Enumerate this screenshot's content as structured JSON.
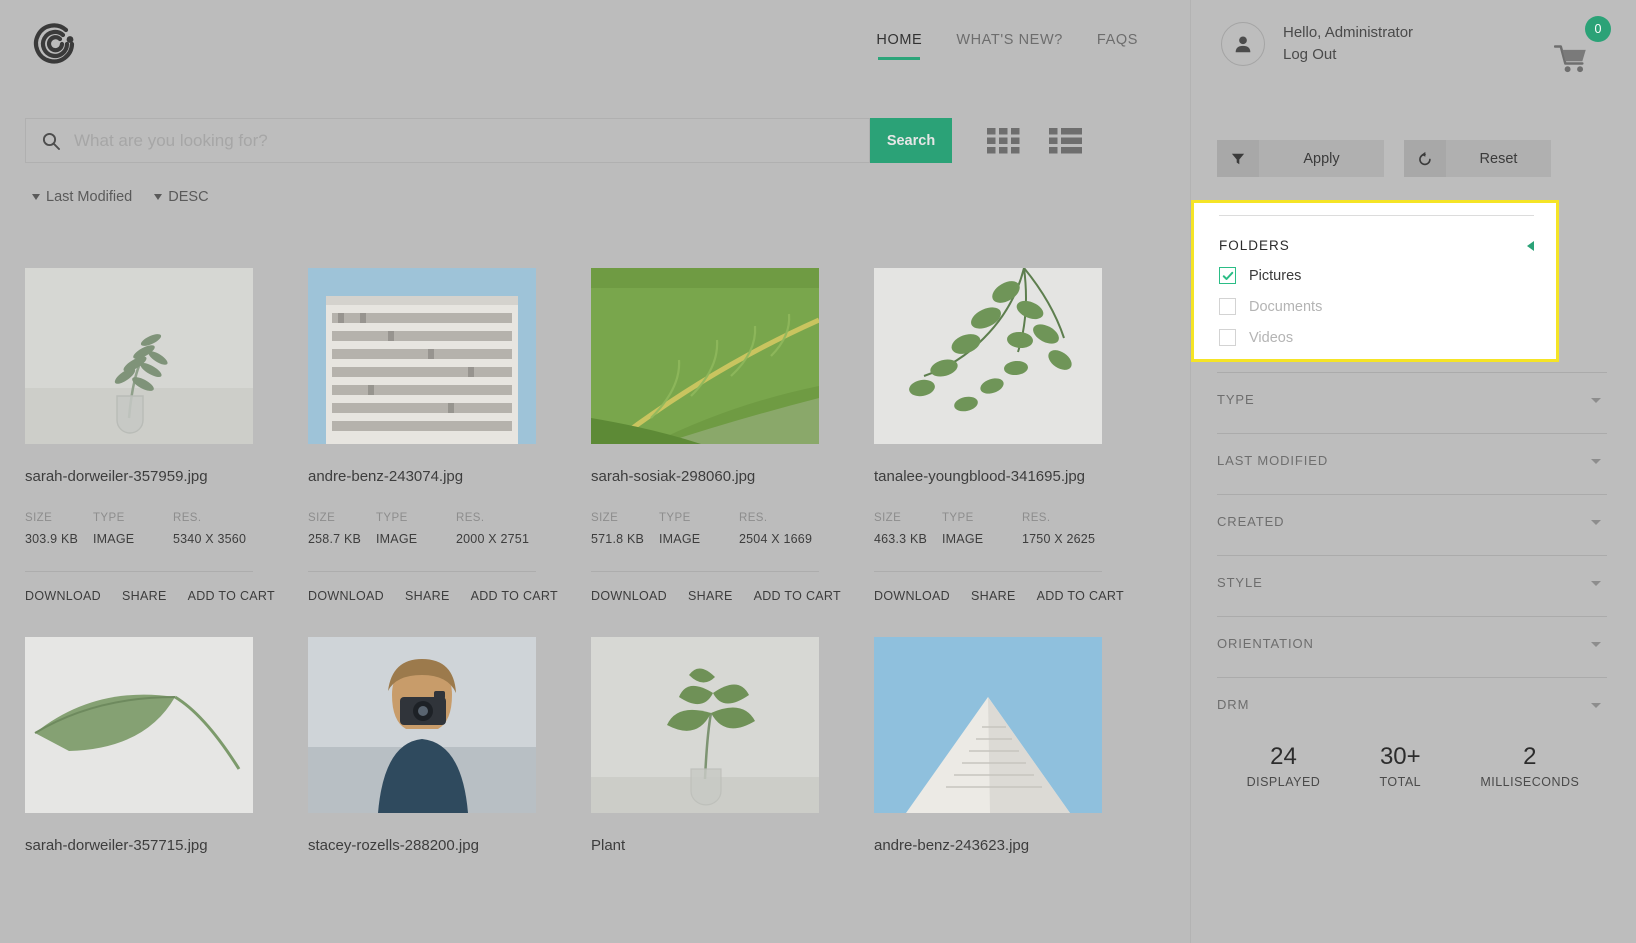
{
  "header": {
    "logo_name": "brand-logo",
    "nav": [
      {
        "label": "HOME",
        "active": true
      },
      {
        "label": "WHAT'S NEW?",
        "active": false
      },
      {
        "label": "FAQS",
        "active": false
      }
    ]
  },
  "search": {
    "placeholder": "What are you looking for?",
    "value": "",
    "button_label": "Search",
    "search_icon": "search-icon",
    "grid_view_icon": "grid-view-icon",
    "list_view_icon": "list-view-icon"
  },
  "sort": {
    "field_label": "Last Modified",
    "direction_label": "DESC"
  },
  "cards": [
    {
      "title": "sarah-dorweiler-357959.jpg",
      "size_label": "SIZE",
      "type_label": "TYPE",
      "res_label": "RES.",
      "size": "303.9 KB",
      "type": "IMAGE",
      "res": "5340 X 3560",
      "actions": [
        "DOWNLOAD",
        "SHARE",
        "ADD TO CART"
      ],
      "thumb": "leaf-in-glass-vase"
    },
    {
      "title": "andre-benz-243074.jpg",
      "size_label": "SIZE",
      "type_label": "TYPE",
      "res_label": "RES.",
      "size": "258.7 KB",
      "type": "IMAGE",
      "res": "2000 X 2751",
      "actions": [
        "DOWNLOAD",
        "SHARE",
        "ADD TO CART"
      ],
      "thumb": "white-apartment-building"
    },
    {
      "title": "sarah-sosiak-298060.jpg",
      "size_label": "SIZE",
      "type_label": "TYPE",
      "res_label": "RES.",
      "size": "571.8 KB",
      "type": "IMAGE",
      "res": "2504 X 1669",
      "actions": [
        "DOWNLOAD",
        "SHARE",
        "ADD TO CART"
      ],
      "thumb": "fiddle-leaf-closeup"
    },
    {
      "title": "tanalee-youngblood-341695.jpg",
      "size_label": "SIZE",
      "type_label": "TYPE",
      "res_label": "RES.",
      "size": "463.3 KB",
      "type": "IMAGE",
      "res": "1750 X 2625",
      "actions": [
        "DOWNLOAD",
        "SHARE",
        "ADD TO CART"
      ],
      "thumb": "hanging-green-plant"
    },
    {
      "title": "sarah-dorweiler-357715.jpg",
      "thumb": "single-leaf-white-bg"
    },
    {
      "title": "stacey-rozells-288200.jpg",
      "thumb": "woman-with-camera"
    },
    {
      "title": "Plant",
      "thumb": "monstera-in-glass"
    },
    {
      "title": "andre-benz-243623.jpg",
      "thumb": "white-building-sky"
    }
  ],
  "sidebar": {
    "user": {
      "greeting": "Hello, Administrator",
      "logout_label": "Log Out",
      "avatar_icon": "user-avatar-icon"
    },
    "cart": {
      "count": "0",
      "icon": "shopping-cart-icon"
    },
    "apply_button": {
      "label": "Apply",
      "icon": "filter-funnel-icon"
    },
    "reset_button": {
      "label": "Reset",
      "icon": "undo-arrow-icon"
    },
    "folders": {
      "title": "FOLDERS",
      "collapse_icon": "collapse-left-arrow-icon",
      "items": [
        {
          "label": "Pictures",
          "checked": true,
          "disabled": false
        },
        {
          "label": "Documents",
          "checked": false,
          "disabled": true
        },
        {
          "label": "Videos",
          "checked": false,
          "disabled": true
        }
      ]
    },
    "filter_sections": [
      {
        "label": "TYPE"
      },
      {
        "label": "LAST MODIFIED"
      },
      {
        "label": "CREATED"
      },
      {
        "label": "STYLE"
      },
      {
        "label": "ORIENTATION"
      },
      {
        "label": "DRM"
      }
    ],
    "stats": [
      {
        "value": "24",
        "label": "DISPLAYED"
      },
      {
        "value": "30+",
        "label": "TOTAL"
      },
      {
        "value": "2",
        "label": "MILLISECONDS"
      }
    ]
  },
  "colors": {
    "accent_green": "#2ba277",
    "highlight_yellow": "#f5e426",
    "page_bg": "#bdbdbd",
    "panel_white": "#ffffff"
  }
}
